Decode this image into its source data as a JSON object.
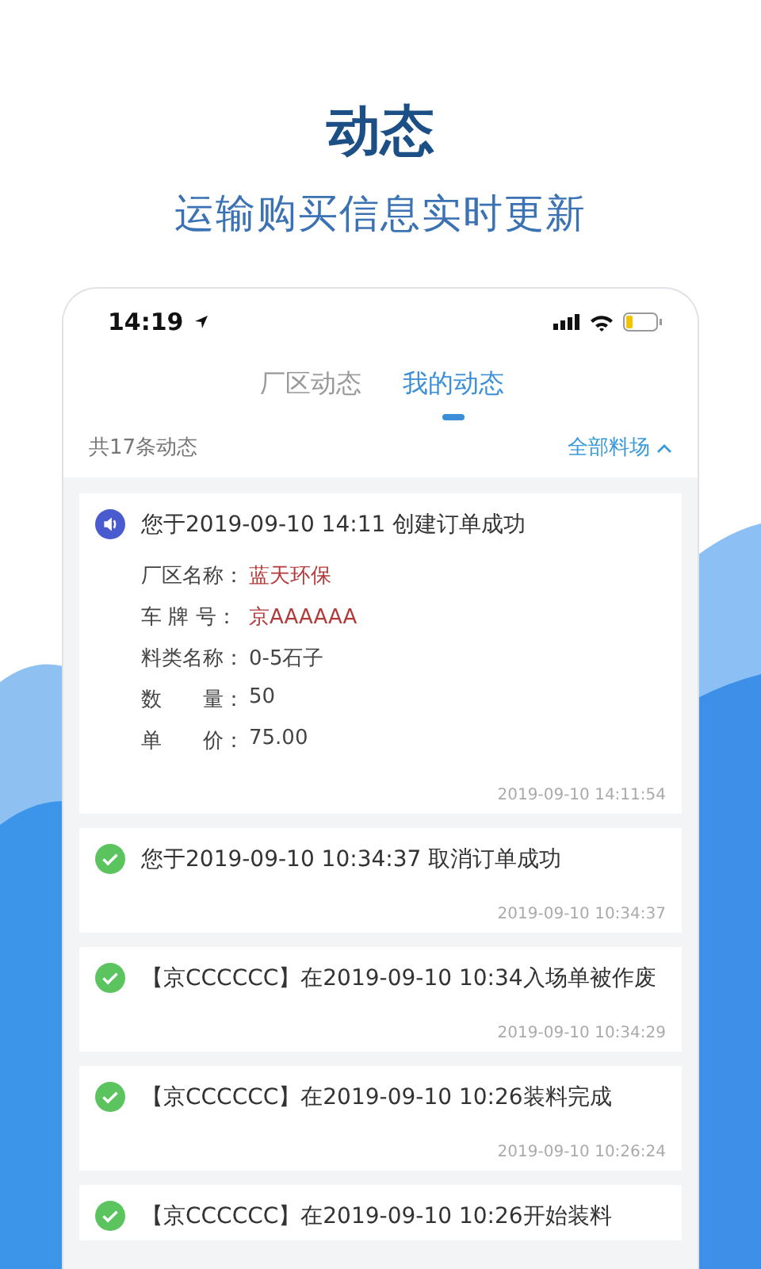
{
  "header": {
    "title": "动态",
    "subtitle": "运输购买信息实时更新"
  },
  "status_bar": {
    "time": "14:19"
  },
  "tabs": [
    {
      "label": "厂区动态",
      "selected": false
    },
    {
      "label": "我的动态",
      "selected": true
    }
  ],
  "summary": {
    "count": "共17条动态",
    "filter": "全部料场",
    "filter_expanded": true
  },
  "items": [
    {
      "kind": "speaker",
      "text": "您于2019-09-10 14:11 创建订单成功",
      "details": [
        {
          "label": "厂区名称：",
          "value": "蓝天环保",
          "highlight": true
        },
        {
          "label": "车 牌 号：",
          "value": "京AAAAAA",
          "highlight": true
        },
        {
          "label": "料类名称：",
          "value": "0-5石子",
          "highlight": false
        },
        {
          "label": "数　　量：",
          "value": "50",
          "highlight": false
        },
        {
          "label": "单　　价：",
          "value": "75.00",
          "highlight": false
        }
      ],
      "time": "2019-09-10 14:11:54"
    },
    {
      "kind": "check",
      "text": "您于2019-09-10 10:34:37 取消订单成功",
      "time": "2019-09-10 10:34:37"
    },
    {
      "kind": "check",
      "text": "【京CCCCCC】在2019-09-10 10:34入场单被作废",
      "time": "2019-09-10 10:34:29"
    },
    {
      "kind": "check",
      "text": "【京CCCCCC】在2019-09-10 10:26装料完成",
      "time": "2019-09-10 10:26:24"
    },
    {
      "kind": "check",
      "text": "【京CCCCCC】在2019-09-10 10:26开始装料"
    }
  ]
}
